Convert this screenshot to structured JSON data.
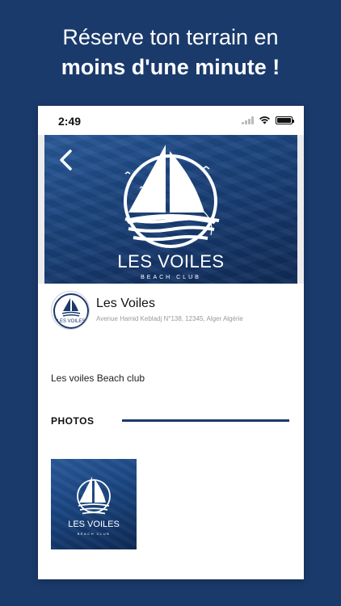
{
  "headline": {
    "line1": "Réserve ton terrain en",
    "line2": "moins d'une minute !"
  },
  "status_bar": {
    "time": "2:49",
    "icons": [
      "signal-icon",
      "wifi-icon",
      "battery-icon"
    ]
  },
  "banner": {
    "title": "LES VOILES",
    "subtitle": "BEACH CLUB",
    "back_icon": "chevron-left-icon"
  },
  "club": {
    "name": "Les Voiles",
    "address": "Avenue Hamid Kebladj N°138, 12345, Alger Algérie",
    "description": "Les voiles Beach club",
    "logo_title": "LES VOILES"
  },
  "photos": {
    "label": "PHOTOS",
    "items": [
      {
        "title": "LES VOILES",
        "subtitle": "BEACH CLUB"
      }
    ]
  },
  "colors": {
    "brand_navy": "#1a3a6b",
    "white": "#ffffff"
  }
}
